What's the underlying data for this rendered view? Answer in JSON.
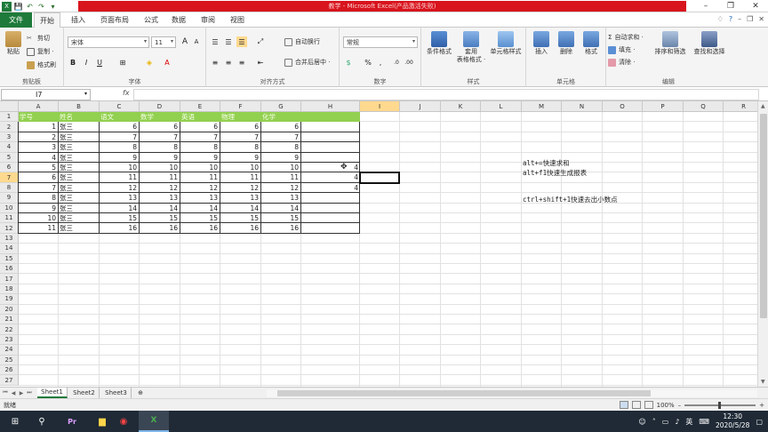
{
  "titlebar": {
    "title": "教学 - Microsoft Excel(产品激活失败)",
    "minimize": "–",
    "restore": "❐",
    "close": "✕"
  },
  "ribbon_tabs": {
    "file": "文件",
    "tabs": [
      {
        "label": "开始"
      },
      {
        "label": "插入"
      },
      {
        "label": "页面布局"
      },
      {
        "label": "公式"
      },
      {
        "label": "数据"
      },
      {
        "label": "审阅"
      },
      {
        "label": "视图"
      }
    ]
  },
  "ribbon": {
    "clipboard": {
      "paste": "粘贴",
      "cut": "剪切",
      "copy": "复制 ·",
      "format_painter": "格式刷",
      "label": "剪贴板"
    },
    "font": {
      "family": "宋体",
      "size": "11",
      "label": "字体",
      "bold": "B",
      "italic": "I",
      "underline": "U",
      "grow": "A",
      "shrink": "A"
    },
    "alignment": {
      "wrap": "自动换行",
      "merge": "合并后居中 ·",
      "label": "对齐方式"
    },
    "number": {
      "format": "常规",
      "label": "数字",
      "percent": "%",
      "comma": ","
    },
    "styles": {
      "conditional": "条件格式",
      "table": "套用\n表格格式 ·",
      "cell": "单元格样式",
      "label": "样式"
    },
    "cells": {
      "insert": "插入",
      "delete": "删除",
      "format": "格式",
      "label": "单元格"
    },
    "editing": {
      "autosum": "自动求和 ·",
      "fill": "填充 ·",
      "clear": "清除 ·",
      "sort": "排序和筛选",
      "find": "查找和选择",
      "label": "编辑"
    }
  },
  "formula_bar": {
    "name_box": "I7",
    "fx": "fx",
    "value": ""
  },
  "columns": [
    "A",
    "B",
    "C",
    "D",
    "E",
    "F",
    "G",
    "H",
    "I",
    "J",
    "K",
    "L",
    "M",
    "N",
    "O",
    "P",
    "Q",
    "R"
  ],
  "selected_column": "I",
  "selected_row": 7,
  "row_numbers": [
    1,
    2,
    3,
    4,
    5,
    6,
    7,
    8,
    9,
    10,
    11,
    12,
    13,
    14,
    15,
    16,
    17,
    18,
    19,
    20,
    21,
    22,
    23,
    24,
    25,
    26,
    27
  ],
  "table": {
    "headers": [
      "学号",
      "姓名",
      "语文",
      "数学",
      "英语",
      "物理",
      "化学"
    ],
    "rows": [
      [
        "1",
        "张三",
        "6",
        "6",
        "6",
        "6",
        "6"
      ],
      [
        "2",
        "张三",
        "7",
        "7",
        "7",
        "7",
        "7"
      ],
      [
        "3",
        "张三",
        "8",
        "8",
        "8",
        "8",
        "8"
      ],
      [
        "4",
        "张三",
        "9",
        "9",
        "9",
        "9",
        "9"
      ],
      [
        "5",
        "张三",
        "10",
        "10",
        "10",
        "10",
        "10"
      ],
      [
        "6",
        "张三",
        "11",
        "11",
        "11",
        "11",
        "11"
      ],
      [
        "7",
        "张三",
        "12",
        "12",
        "12",
        "12",
        "12"
      ],
      [
        "8",
        "张三",
        "13",
        "13",
        "13",
        "13",
        "13"
      ],
      [
        "9",
        "张三",
        "14",
        "14",
        "14",
        "14",
        "14"
      ],
      [
        "10",
        "张三",
        "15",
        "15",
        "15",
        "15",
        "15"
      ],
      [
        "11",
        "张三",
        "16",
        "16",
        "16",
        "16",
        "16"
      ]
    ]
  },
  "h_column_values": [
    "4",
    "4",
    "4"
  ],
  "notes": [
    "alt+=快速求和",
    "alt+f1快速生成报表",
    "ctrl+shift+1快速去出小数点"
  ],
  "sheets": [
    {
      "label": "Sheet1"
    },
    {
      "label": "Sheet2"
    },
    {
      "label": "Sheet3"
    }
  ],
  "status": {
    "text": "就绪",
    "zoom": "100%",
    "zoom_minus": "–",
    "zoom_plus": "+"
  },
  "taskbar": {
    "time": "12:30",
    "date": "2020/5/28",
    "ime": "英",
    "notify": "1"
  },
  "colors": {
    "header_fill": "#92d050",
    "excel_green": "#1d7a3a",
    "title_red": "#d8141d",
    "selection": "#ffd98e"
  }
}
